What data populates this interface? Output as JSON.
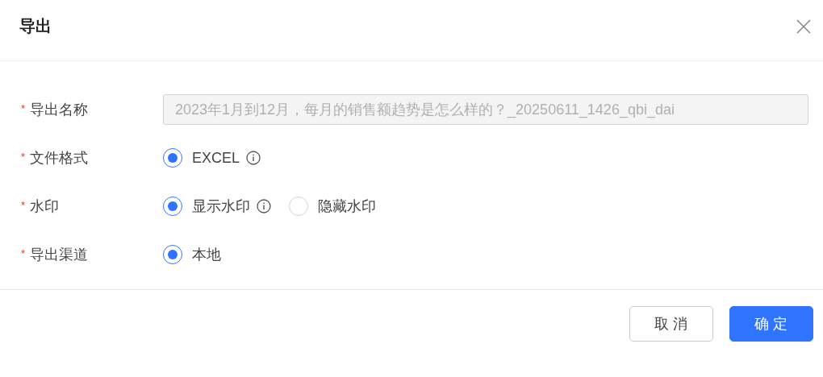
{
  "dialog": {
    "title": "导出"
  },
  "form": [
    {
      "kind": "input",
      "label": "导出名称",
      "mark": "*",
      "value": "2023年1月到12月，每月的销售额趋势是怎么样的？_20250611_1426_qbi_dai",
      "disabled": true
    },
    {
      "kind": "radio",
      "label": "文件格式",
      "mark": "*",
      "options": [
        {
          "label": "EXCEL",
          "selected": true,
          "info": true
        }
      ]
    },
    {
      "kind": "radio",
      "label": "水印",
      "mark": "*",
      "options": [
        {
          "label": "显示水印",
          "selected": true,
          "info": true
        },
        {
          "label": "隐藏水印",
          "selected": false,
          "info": false
        }
      ]
    },
    {
      "kind": "radio",
      "label": "导出渠道",
      "mark": "*",
      "options": [
        {
          "label": "本地",
          "selected": true,
          "info": false
        }
      ]
    }
  ],
  "buttons": [
    {
      "label": "取 消",
      "kind": "default"
    },
    {
      "label": "确 定",
      "kind": "primary"
    }
  ]
}
